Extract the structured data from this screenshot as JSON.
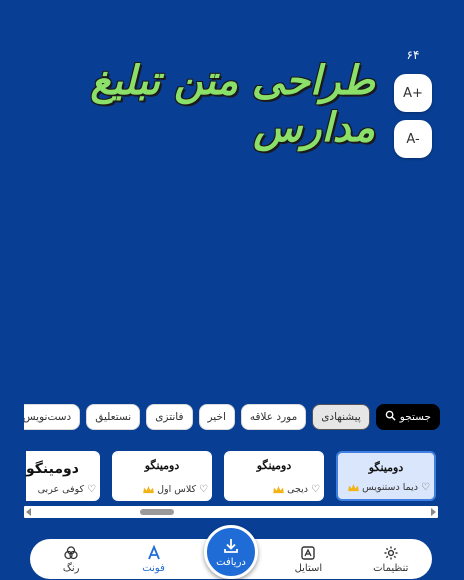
{
  "size_value": "۶۴",
  "zoom_in_label": "A+",
  "zoom_out_label": "A-",
  "preview_text": "طراحی متن تبلیغ مدارس",
  "chips": {
    "search": "جستجو",
    "suggested": "پیشنهادی",
    "favorites": "مورد علاقه",
    "recent": "اخیر",
    "fantasy": "فانتزی",
    "nastaliq": "نستعلیق",
    "handwriting": "دست‌نویس"
  },
  "fonts": [
    {
      "sample": "دومینگو",
      "name": "دیما دستنویس",
      "premium": true
    },
    {
      "sample": "دومینگو",
      "name": "دیجی",
      "premium": true
    },
    {
      "sample": "دومینگو",
      "name": "کلاس اول",
      "premium": true
    },
    {
      "sample": "دومینگو",
      "name": "کوفی عربی",
      "premium": false
    }
  ],
  "nav": {
    "settings": "تنظیمات",
    "style": "استایل",
    "download": "دریافت",
    "font": "فونت",
    "color": "رنگ"
  },
  "colors": {
    "background": "#083f95",
    "accent": "#1f6cd6",
    "preview_text": "#8be06a",
    "crown": "#f2b316"
  }
}
